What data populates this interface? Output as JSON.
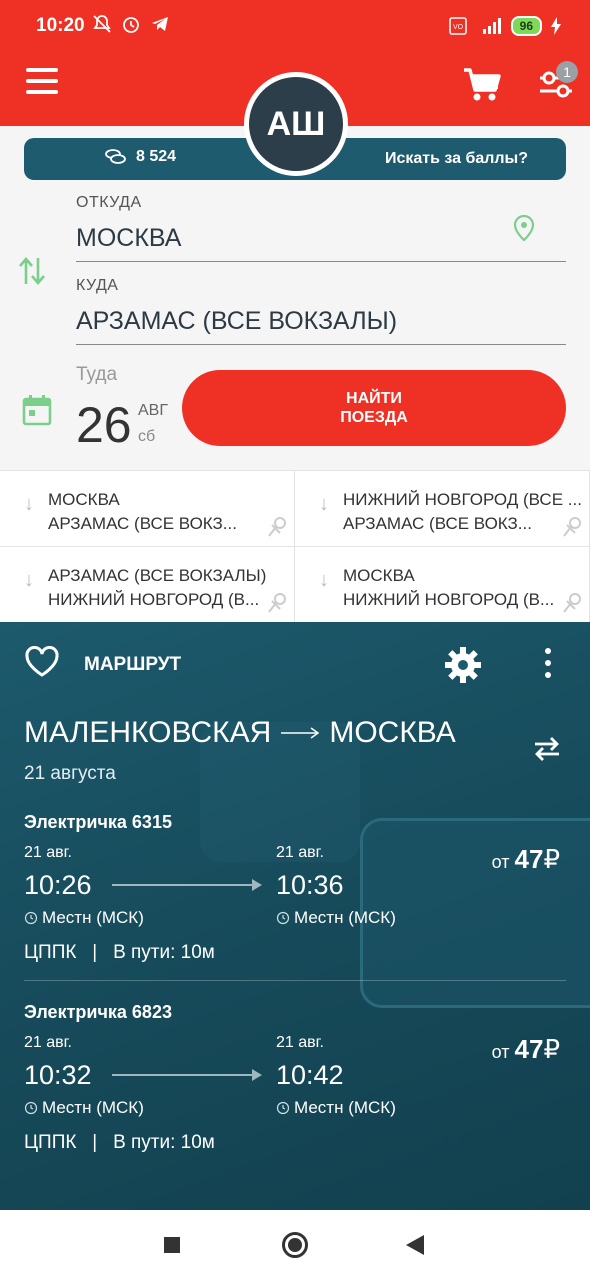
{
  "status": {
    "time": "10:20",
    "battery": "96",
    "network": "4G"
  },
  "header": {
    "avatar_initials": "АШ",
    "filter_badge": "1"
  },
  "points": {
    "balance": "8 524",
    "search_label": "Искать за баллы?"
  },
  "search": {
    "from_label": "ОТКУДА",
    "from_value": "МОСКВА",
    "to_label": "КУДА",
    "to_value": "АРЗАМАС (ВСЕ ВОКЗАЛЫ)",
    "date_label": "Туда",
    "date_day": "26",
    "date_month": "АВГ",
    "date_weekday": "сб",
    "find_button_line1": "НАЙТИ",
    "find_button_line2": "ПОЕЗДА"
  },
  "recent": [
    {
      "from": "МОСКВА",
      "to": "АРЗАМАС (ВСЕ ВОКЗ..."
    },
    {
      "from": "НИЖНИЙ НОВГОРОД (ВСЕ ...",
      "to": "АРЗАМАС (ВСЕ ВОКЗ..."
    },
    {
      "from": "АРЗАМАС (ВСЕ ВОКЗАЛЫ)",
      "to": "НИЖНИЙ НОВГОРОД (В..."
    },
    {
      "from": "МОСКВА",
      "to": "НИЖНИЙ НОВГОРОД (В..."
    }
  ],
  "route": {
    "header_label": "МАРШРУТ",
    "from": "МАЛЕНКОВСКАЯ",
    "to": "МОСКВА",
    "date": "21 августа",
    "trains": [
      {
        "name": "Электричка 6315",
        "dep_date": "21 авг.",
        "dep_time": "10:26",
        "dep_tz": "Местн (МСК)",
        "arr_date": "21 авг.",
        "arr_time": "10:36",
        "arr_tz": "Местн (МСК)",
        "price_prefix": "от",
        "price": "47",
        "currency": "₽",
        "carrier": "ЦППК",
        "separator": "|",
        "duration": "В пути: 10м"
      },
      {
        "name": "Электричка 6823",
        "dep_date": "21 авг.",
        "dep_time": "10:32",
        "dep_tz": "Местн (МСК)",
        "arr_date": "21 авг.",
        "arr_time": "10:42",
        "arr_tz": "Местн (МСК)",
        "price_prefix": "от",
        "price": "47",
        "currency": "₽",
        "carrier": "ЦППК",
        "separator": "|",
        "duration": "В пути: 10м"
      }
    ]
  },
  "colors": {
    "brand_red": "#ee3124",
    "points_bar": "#1f5b6e",
    "route_bg": "#174c5c",
    "accent_green": "#7ccf8a"
  },
  "icons": [
    "menu-icon",
    "cart-icon",
    "filter-icon",
    "coins-icon",
    "location-pin-icon",
    "swap-vertical-icon",
    "calendar-icon",
    "pin-icon",
    "heart-icon",
    "gear-icon",
    "more-vert-icon",
    "swap-horizontal-icon",
    "clock-icon"
  ]
}
